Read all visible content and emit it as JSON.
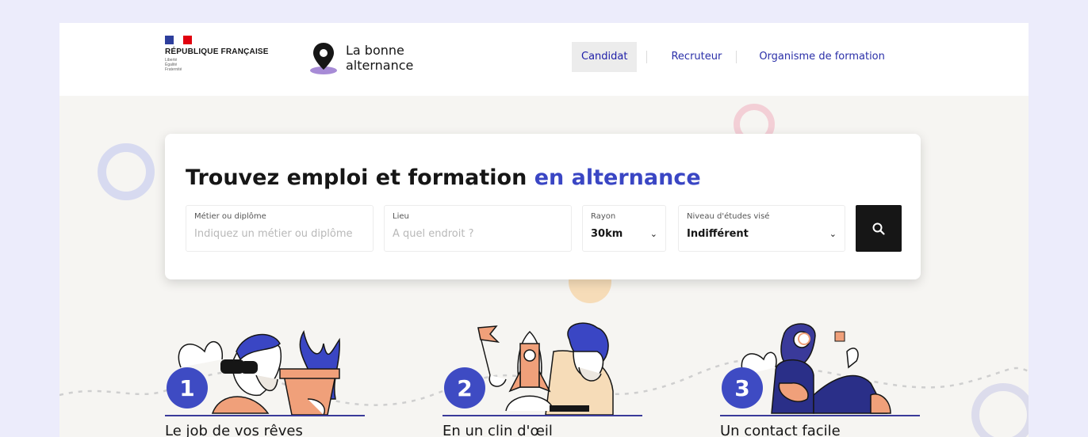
{
  "header": {
    "republic": "RÉPUBLIQUE FRANÇAISE",
    "motto": [
      "Liberté",
      "Égalité",
      "Fraternité"
    ],
    "brand_line1": "La bonne",
    "brand_line2": "alternance",
    "nav": [
      "Candidat",
      "Recruteur",
      "Organisme de formation"
    ],
    "active_nav": "Candidat"
  },
  "search": {
    "title_main": "Trouvez emploi et formation",
    "title_accent": "en alternance",
    "job_label": "Métier ou diplôme",
    "job_placeholder": "Indiquez un métier ou diplôme",
    "place_label": "Lieu",
    "place_placeholder": "A quel endroit ?",
    "radius_label": "Rayon",
    "radius_value": "30km",
    "level_label": "Niveau d'études visé",
    "level_value": "Indifférent",
    "search_icon": "search-icon"
  },
  "steps": [
    {
      "number": "1",
      "title": "Le job de vos rêves"
    },
    {
      "number": "2",
      "title": "En un clin d'œil"
    },
    {
      "number": "3",
      "title": "Un contact facile"
    }
  ],
  "colors": {
    "accent": "#3a46c4",
    "badge": "#3e4bc3",
    "background": "#ececfb",
    "page": "#f6f5f2"
  }
}
